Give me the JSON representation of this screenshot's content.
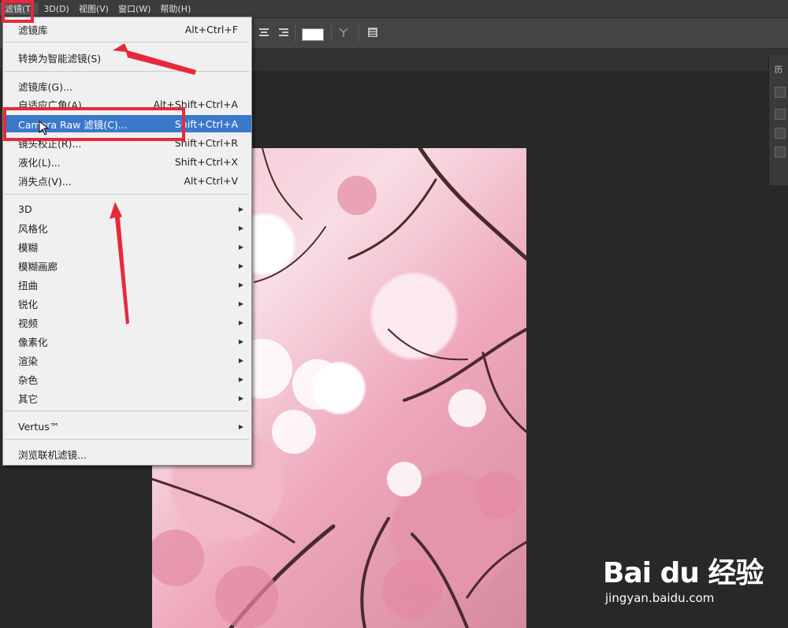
{
  "menubar": {
    "items": [
      {
        "label": "滤镜(T)"
      },
      {
        "label": "3D(D)"
      },
      {
        "label": "视图(V)"
      },
      {
        "label": "窗口(W)"
      },
      {
        "label": "帮助(H)"
      }
    ]
  },
  "right_panel": {
    "title": "历"
  },
  "filter_menu": {
    "items": [
      {
        "label": "滤镜库",
        "shortcut": "Alt+Ctrl+F"
      },
      {
        "label": "转换为智能滤镜(S)",
        "shortcut": ""
      },
      {
        "label": "滤镜库(G)...",
        "shortcut": ""
      },
      {
        "label": "自适应广角(A)...",
        "shortcut": "Alt+Shift+Ctrl+A"
      },
      {
        "label": "Camera Raw 滤镜(C)...",
        "shortcut": "Shift+Ctrl+A"
      },
      {
        "label": "镜头校正(R)...",
        "shortcut": "Shift+Ctrl+R"
      },
      {
        "label": "液化(L)...",
        "shortcut": "Shift+Ctrl+X"
      },
      {
        "label": "消失点(V)...",
        "shortcut": "Alt+Ctrl+V"
      },
      {
        "label": "3D",
        "submenu": true
      },
      {
        "label": "风格化",
        "submenu": true
      },
      {
        "label": "模糊",
        "submenu": true
      },
      {
        "label": "模糊画廊",
        "submenu": true
      },
      {
        "label": "扭曲",
        "submenu": true
      },
      {
        "label": "锐化",
        "submenu": true
      },
      {
        "label": "视频",
        "submenu": true
      },
      {
        "label": "像素化",
        "submenu": true
      },
      {
        "label": "渲染",
        "submenu": true
      },
      {
        "label": "杂色",
        "submenu": true
      },
      {
        "label": "其它",
        "submenu": true
      },
      {
        "label": "Vertus™",
        "submenu": true
      },
      {
        "label": "浏览联机滤镜...",
        "shortcut": ""
      }
    ]
  },
  "watermark": {
    "logo": "Bai du 经验",
    "url": "jingyan.baidu.com"
  },
  "colors": {
    "highlight": "#3a78c9",
    "annotation": "#e8283a"
  }
}
